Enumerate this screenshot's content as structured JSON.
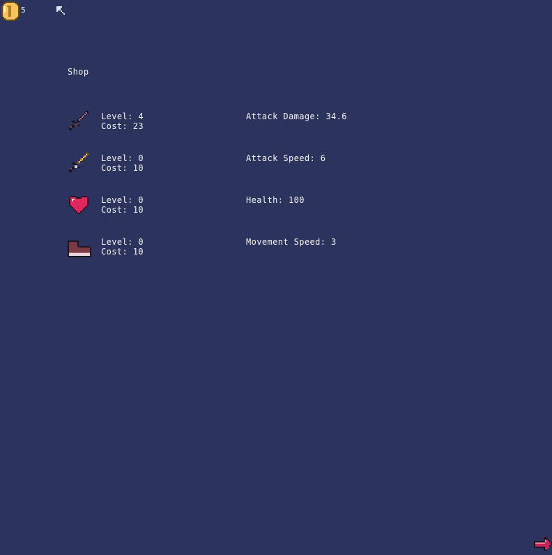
{
  "hud": {
    "coins": "5",
    "coin_icon": "coin-icon",
    "cursor_icon": "cursor-arrow-icon"
  },
  "shop": {
    "title": "Shop",
    "items": [
      {
        "icon": "dark-sword-icon",
        "level": "Level: 4",
        "cost": "Cost: 23",
        "stat": "Attack Damage: 34.6"
      },
      {
        "icon": "golden-sword-icon",
        "level": "Level: 0",
        "cost": "Cost: 10",
        "stat": "Attack Speed: 6"
      },
      {
        "icon": "heart-icon",
        "level": "Level: 0",
        "cost": "Cost: 10",
        "stat": "Health: 100"
      },
      {
        "icon": "boot-icon",
        "level": "Level: 0",
        "cost": "Cost: 10",
        "stat": "Movement Speed: 3"
      }
    ]
  },
  "nav": {
    "next_icon": "next-arrow-icon"
  },
  "colors": {
    "background": "#2c335c",
    "text": "#f4f4f4",
    "coin": "#f2c35f",
    "heart": "#e0285f",
    "boot": "#7a3a44",
    "arrow": "#c8265a"
  }
}
